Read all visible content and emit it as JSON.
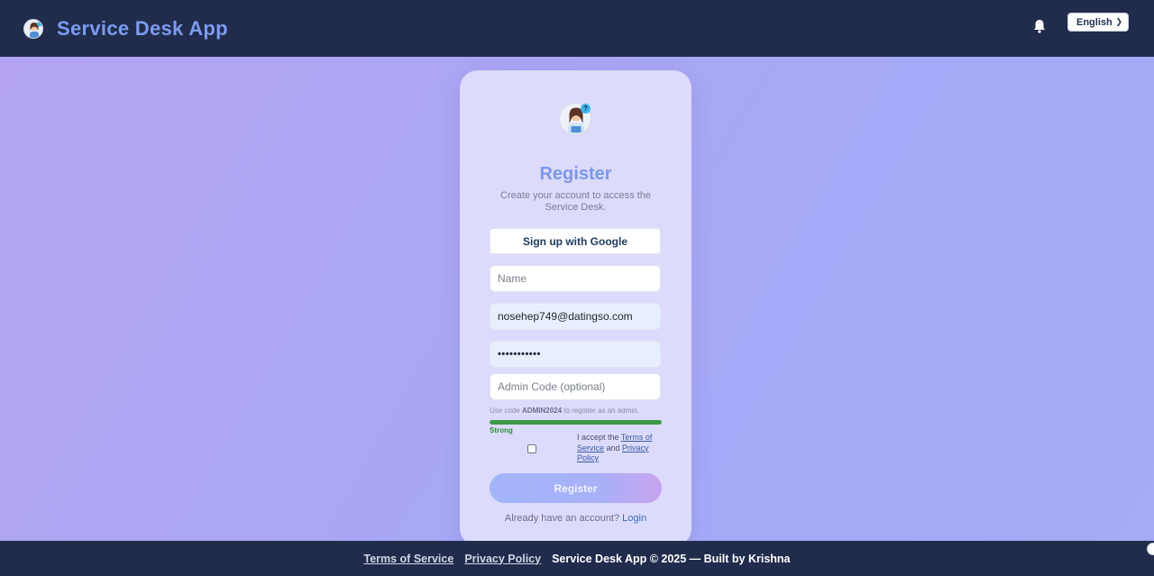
{
  "header": {
    "title": "Service Desk App",
    "logo_icon": "support-agent-icon",
    "notification_icon": "bell-icon",
    "language_selected": "English"
  },
  "register": {
    "avatar_icon": "support-agent-icon",
    "badge": "?",
    "title": "Register",
    "subtitle": "Create your account to access the Service Desk.",
    "google_button": "Sign up with Google",
    "name_placeholder": "Name",
    "email_value": "nosehep749@datingso.com",
    "password_value": "•••••••••••",
    "admin_placeholder": "Admin Code (optional)",
    "hint_prefix": "Use code ",
    "hint_code": "ADMIN2024",
    "hint_suffix": " to register as an admin.",
    "strength_fraction": 1.0,
    "strength_color": "#3c9a45",
    "strength_label": "Strong",
    "terms_prefix": "I accept the ",
    "terms_link": "Terms of Service",
    "terms_and": " and ",
    "privacy_link": "Privacy Policy",
    "terms_checked": false,
    "submit_button": "Register",
    "login_prompt": "Already have an account?",
    "login_link": "Login"
  },
  "footer": {
    "terms": "Terms of Service",
    "privacy": "Privacy Policy",
    "copyright": "Service Desk App © 2025 — Built by Krishna"
  },
  "colors": {
    "header_bg": "#212c4c",
    "brand_accent": "#7b98ea",
    "page_gradient_start": "#b3a3f2",
    "page_gradient_end": "#a7aaf5"
  }
}
